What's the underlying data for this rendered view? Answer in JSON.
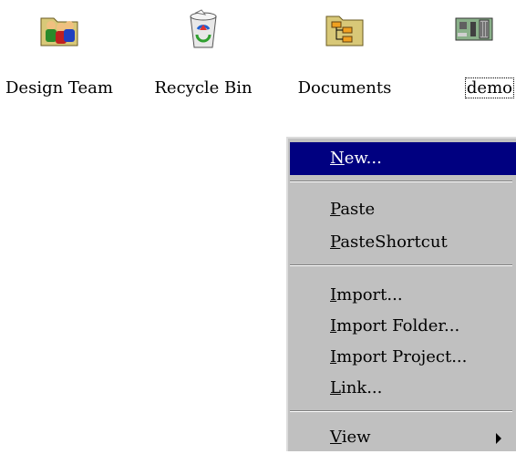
{
  "desktop": {
    "icons": [
      {
        "name": "Design Team",
        "icon": "people-folder-icon"
      },
      {
        "name": "Recycle Bin",
        "icon": "recycle-bin-icon"
      },
      {
        "name": "Documents",
        "icon": "documents-folder-icon"
      },
      {
        "name": "demo",
        "icon": "project-board-icon",
        "selected": true
      }
    ]
  },
  "context_menu": {
    "items": [
      {
        "label_first": "N",
        "label_rest": "ew...",
        "highlighted": true
      },
      {
        "label_first": "P",
        "label_rest": "aste"
      },
      {
        "label_first": "P",
        "label_rest": "asteShortcut"
      },
      {
        "label_first": "I",
        "label_rest": "mport..."
      },
      {
        "label_first": "I",
        "label_rest": "mport Folder..."
      },
      {
        "label_first": "I",
        "label_rest": "mport Project..."
      },
      {
        "label_first": "L",
        "label_rest": "ink..."
      },
      {
        "label_first": "V",
        "label_rest": "iew",
        "submenu": true
      }
    ]
  },
  "colors": {
    "highlight": "#000080",
    "menu_bg": "#c0c0c0"
  }
}
